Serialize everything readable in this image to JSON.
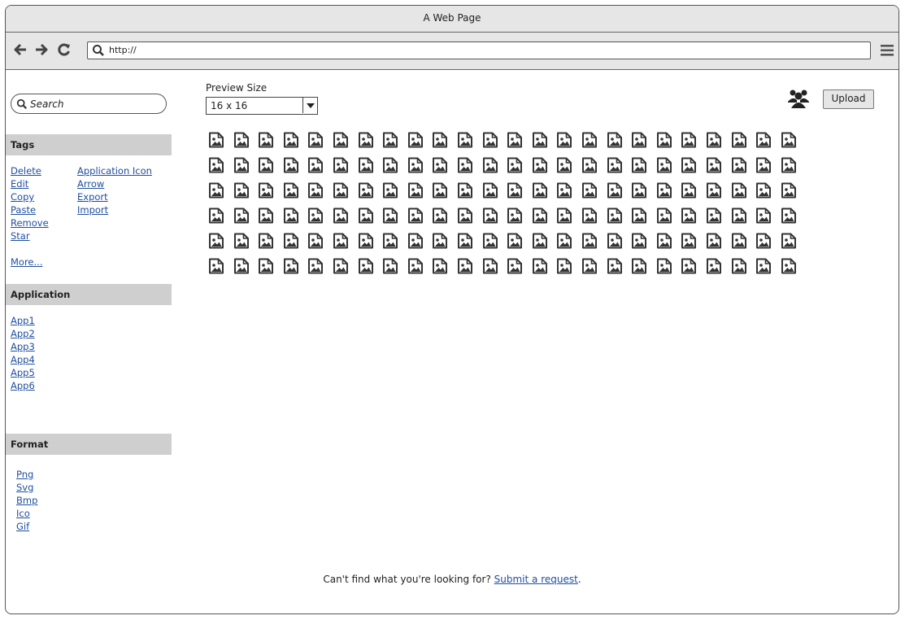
{
  "window": {
    "title": "A Web Page"
  },
  "toolbar": {
    "url": "http://"
  },
  "search": {
    "placeholder": "Search"
  },
  "tags": {
    "header": "Tags",
    "col1": [
      "Delete",
      "Edit",
      "Copy",
      "Paste",
      "Remove",
      "Star"
    ],
    "col2": [
      "Application Icon",
      "Arrow",
      "Export",
      "Import"
    ],
    "more": "More..."
  },
  "application": {
    "header": "Application",
    "items": [
      "App1",
      "App2",
      "App3",
      "App4",
      "App5",
      "App6"
    ]
  },
  "format": {
    "header": "Format",
    "items": [
      "Png",
      "Svg",
      "Bmp",
      "Ico",
      "Gif"
    ]
  },
  "preview": {
    "label": "Preview Size",
    "selected": "16 x 16"
  },
  "upload": {
    "label": "Upload"
  },
  "icon_grid": {
    "rows": 6,
    "cols": 24,
    "icon": "image-file-icon"
  },
  "footer": {
    "text": "Can't find what you're looking for?",
    "link": "Submit a request",
    "suffix": "."
  }
}
